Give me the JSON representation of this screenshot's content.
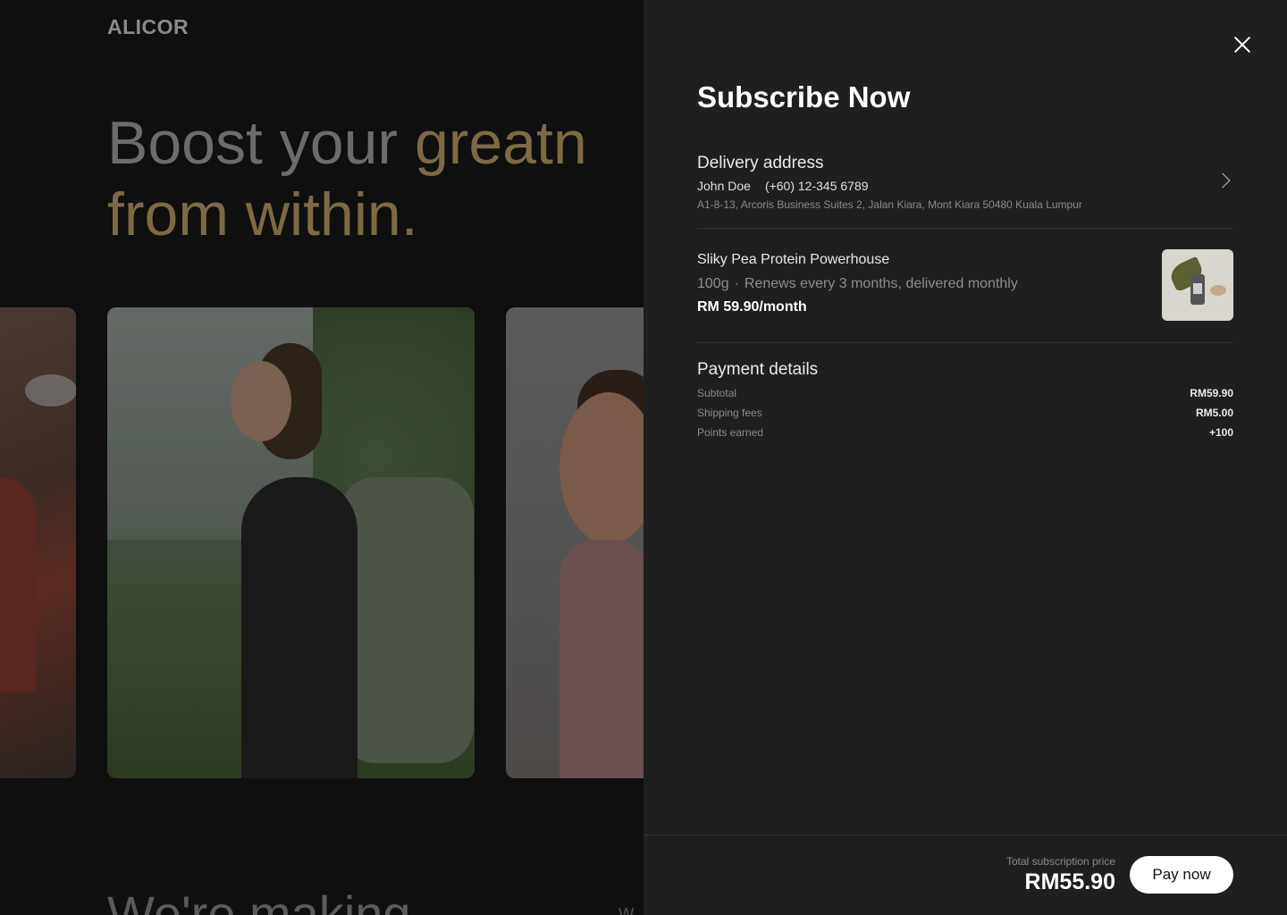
{
  "background": {
    "logo": "ALICOR",
    "hero_line1_plain": "Boost your ",
    "hero_line1_gold": "greatn",
    "hero_line2": "from within.",
    "bottom_heading": "We're making",
    "bottom_fragment": "w"
  },
  "modal": {
    "title": "Subscribe Now",
    "delivery": {
      "heading": "Delivery address",
      "name": "John Doe",
      "phone": "(+60) 12-345 6789",
      "address": "A1-8-13, Arcoris Business Suites 2, Jalan Kiara, Mont Kiara 50480 Kuala Lumpur"
    },
    "product": {
      "name": "Sliky Pea Protein Powerhouse",
      "size": "100g",
      "separator": "·",
      "schedule": "Renews every 3 months, delivered monthly",
      "price": "RM 59.90/month"
    },
    "payment": {
      "heading": "Payment details",
      "rows": [
        {
          "label": "Subtotal",
          "value": "RM59.90"
        },
        {
          "label": "Shipping fees",
          "value": "RM5.00"
        },
        {
          "label": "Points earned",
          "value": "+100"
        }
      ]
    },
    "footer": {
      "total_label": "Total subscription price",
      "total_value": "RM55.90",
      "pay_button": "Pay now"
    }
  }
}
